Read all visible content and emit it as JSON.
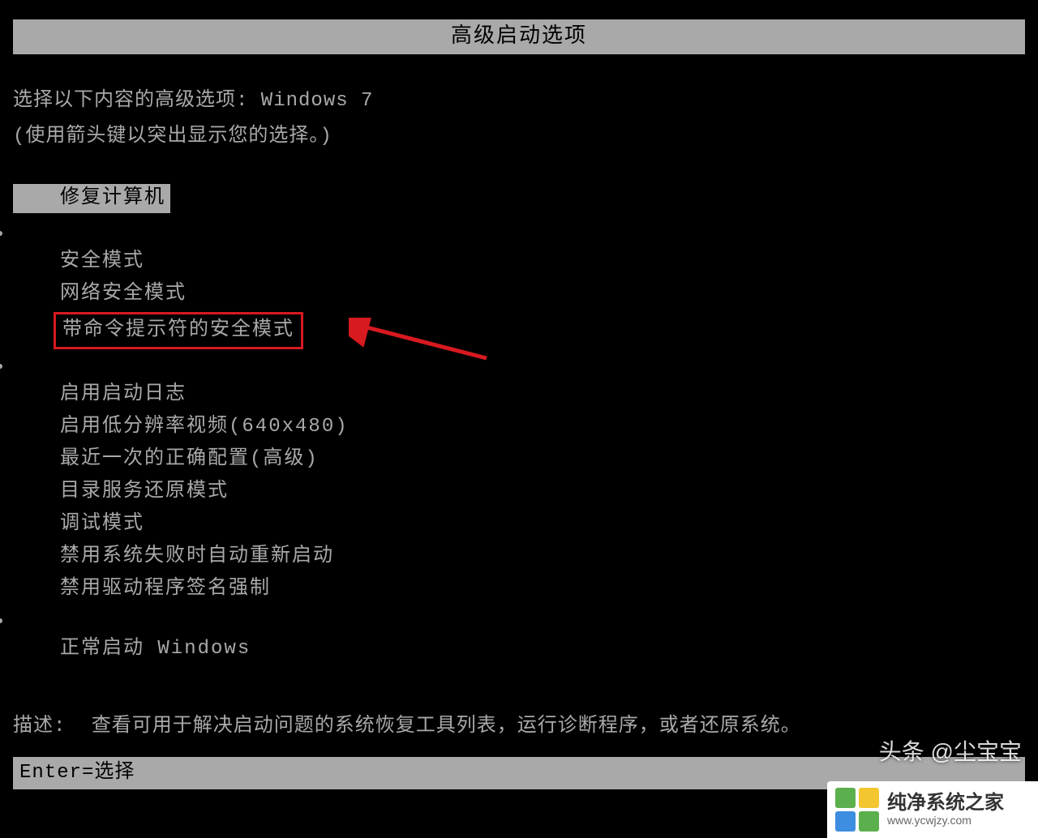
{
  "title": "高级启动选项",
  "instruction_prefix": "选择以下内容的高级选项:",
  "instruction_os": " Windows 7",
  "instruction_sub": "(使用箭头键以突出显示您的选择。)",
  "menu": {
    "repair": "修复计算机",
    "group1": [
      "安全模式",
      "网络安全模式",
      "带命令提示符的安全模式"
    ],
    "group2": [
      "启用启动日志",
      "启用低分辨率视频(640x480)",
      "最近一次的正确配置(高级)",
      "目录服务还原模式",
      "调试模式",
      "禁用系统失败时自动重新启动",
      "禁用驱动程序签名强制"
    ],
    "normal": "正常启动 Windows"
  },
  "description_label": "描述:",
  "description_text": "查看可用于解决启动问题的系统恢复工具列表，运行诊断程序，或者还原系统。",
  "footer": "Enter=选择",
  "watermark_text": "头条 @尘宝宝",
  "logo": {
    "main": "纯净系统之家",
    "sub": "www.ycwjzy.com"
  },
  "colors": {
    "highlight_border": "#d71920",
    "bar_bg": "#a9a9a9"
  }
}
